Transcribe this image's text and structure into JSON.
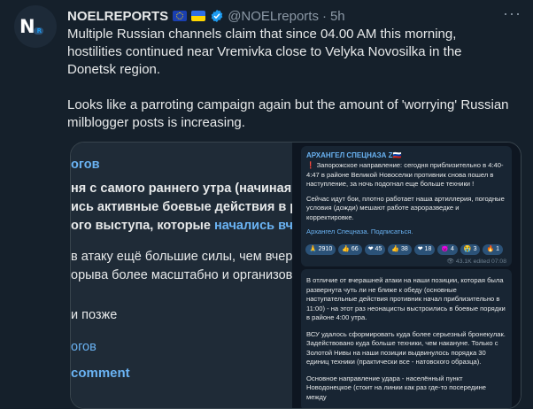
{
  "author": {
    "name": "NOELREPORTS",
    "handle": "@NOELreports",
    "separator": "·",
    "time": "5h",
    "avatar_text_n": "N",
    "avatar_text_r": "R"
  },
  "tweet": {
    "paragraph1": "Multiple Russian channels claim that since 04.00 AM this morning, hostilities continued near Vremivka close to Velyka Novosilka in the Donetsk region.",
    "paragraph2": "Looks like a parroting campaign again but the amount of 'worrying' Russian milblogger posts is increasing."
  },
  "icons": {
    "more": "more-icon",
    "verified": "verified-badge-icon",
    "flag1": "eu-flag-icon",
    "flag2": "ukraine-flag-icon"
  },
  "colors": {
    "background": "#15202b",
    "link": "#1d9bf0",
    "telegram_link": "#6ab3f3"
  },
  "media_left": {
    "line1": "огов",
    "line2": "ня с самого раннего утра (начиная с 04",
    "line3": "ись активные боевые действия в райо",
    "line4_a": "ого выступа, которые ",
    "line4_b": "начались вчера",
    "line5": "в атаку ещё большие силы, чем вчера, п",
    "line6": "орыва более масштабно и организованн",
    "line7": "и позже",
    "line8": "огов",
    "line9": "comment"
  },
  "media_right": {
    "card1": {
      "channel": "АРХАНГЕЛ СПЕЦНАЗА Z🇷🇺",
      "p1": "❗ Запорожское направление: сегодня приблизительно в 4:40-4:47 в районе Великой Новоселки противник снова пошел в наступление, за ночь подогнал еще больше техники !",
      "p2": "Сейчас идут бои, плотно работает наша артиллерия, погодные условия (дожди) мешают работе аэроразведке и корректировке.",
      "p3": "Архангел Спецназа. Подписаться.",
      "reactions": [
        "🙏 2910",
        "👍 66",
        "❤ 45",
        "👍 38",
        "❤ 18",
        "😈 4",
        "😭 3",
        "🔥 1"
      ],
      "views": "👁 43.1K",
      "edited": "edited 07:08"
    },
    "card2": {
      "p1": "В отличие от вчерашней атаки на наши позиции, которая была развернута чуть ли не ближе к обеду (основные наступательные действия противник начал приблизительно в 11:00) - на этот раз неонацисты выстроились в боевые порядки в районе 4:00 утра.",
      "p2": "ВСУ удалось сформировать куда более серьезный бронекулак. Задействовано куда больше техники, чем накануне. Только с Золотой Нивы на наши позиции выдвинулось порядка 30 единиц техники (практически все - натовского образца).",
      "p3": "Основное направление удара - населённый пункт Новодонецкое (стоит на линии как раз где-то посередине между"
    }
  }
}
